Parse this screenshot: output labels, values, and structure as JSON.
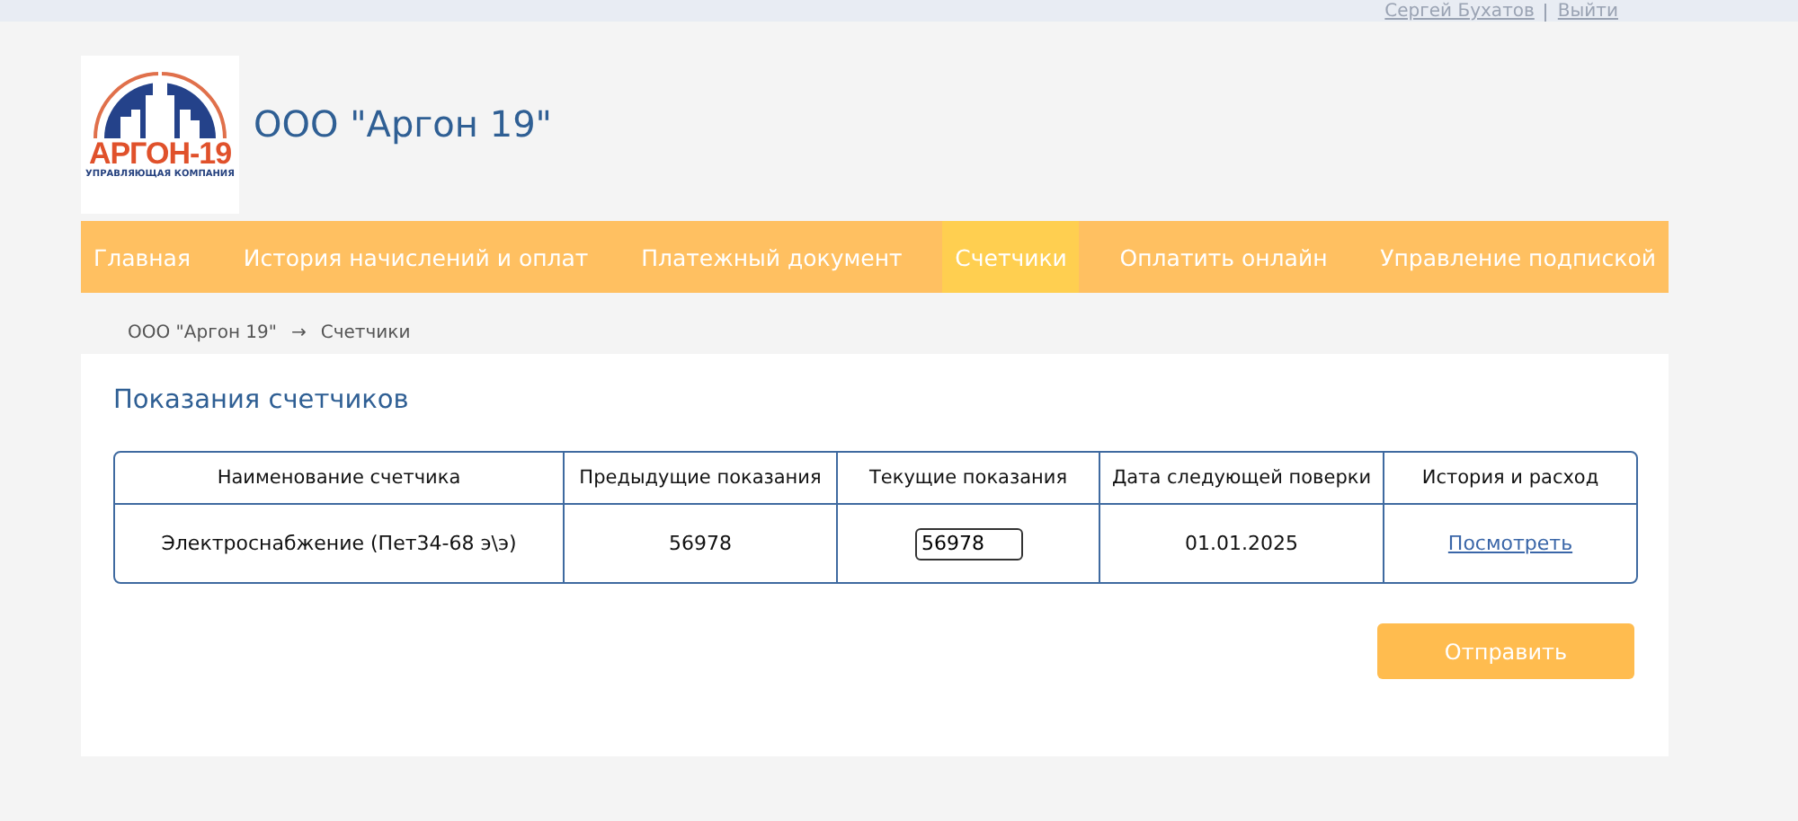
{
  "user_bar": {
    "user": "Сергей Бухатов",
    "logout": "Выйти"
  },
  "logo": {
    "name": "АРГОН-19",
    "tagline": "УПРАВЛЯЮЩАЯ КОМПАНИЯ"
  },
  "company": "ООО \"Аргон 19\"",
  "nav": [
    {
      "label": "Главная",
      "selected": false
    },
    {
      "label": "История начислений и оплат",
      "selected": false
    },
    {
      "label": "Платежный документ",
      "selected": false
    },
    {
      "label": "Счетчики",
      "selected": true
    },
    {
      "label": "Оплатить онлайн",
      "selected": false
    },
    {
      "label": "Управление подпиской",
      "selected": false
    }
  ],
  "breadcrumb": [
    "ООО \"Аргон 19\"",
    "Счетчики"
  ],
  "breadcrumb_separator": "→",
  "title": "Показания счетчиков",
  "table": {
    "columns": [
      "Наименование счетчика",
      "Предыдущие показания",
      "Текущие показания",
      "Дата следующей поверки",
      "История и расход"
    ],
    "rows": [
      {
        "name": "Электроснабжение (Пет34-68 э\\э)",
        "previous": "56978",
        "current": "56978",
        "next_check": "01.01.2025",
        "history": "Посмотреть"
      }
    ]
  },
  "submit": "Отправить"
}
